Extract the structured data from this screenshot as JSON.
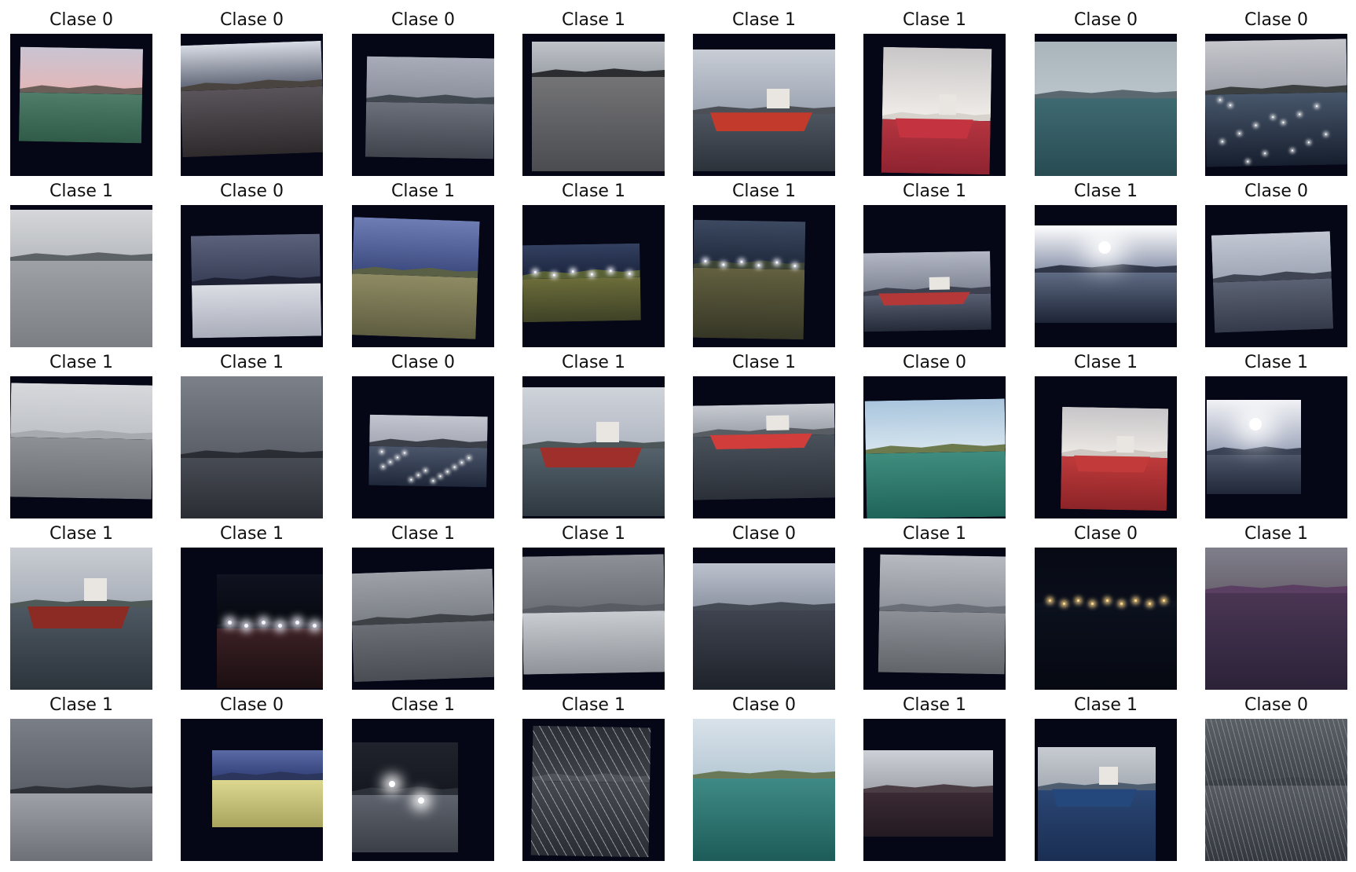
{
  "figure": {
    "cells": [
      {
        "label": "Clase 0",
        "scene": "harbor-dusk"
      },
      {
        "label": "Clase 0",
        "scene": "pier-cloudy"
      },
      {
        "label": "Clase 0",
        "scene": "harbor-gray"
      },
      {
        "label": "Clase 1",
        "scene": "coal-yard"
      },
      {
        "label": "Clase 1",
        "scene": "red-ship-crane"
      },
      {
        "label": "Clase 1",
        "scene": "red-ship-stern"
      },
      {
        "label": "Clase 0",
        "scene": "open-sea-overcast"
      },
      {
        "label": "Clase 0",
        "scene": "sea-glitter"
      },
      {
        "label": "Clase 1",
        "scene": "gray-port-ship"
      },
      {
        "label": "Clase 0",
        "scene": "night-pile"
      },
      {
        "label": "Clase 1",
        "scene": "crane-evening"
      },
      {
        "label": "Clase 1",
        "scene": "night-crane-lights"
      },
      {
        "label": "Clase 1",
        "scene": "night-dock"
      },
      {
        "label": "Clase 1",
        "scene": "tug-ship-dusk"
      },
      {
        "label": "Clase 1",
        "scene": "sun-glare"
      },
      {
        "label": "Clase 0",
        "scene": "harbor-gray-dark"
      },
      {
        "label": "Clase 1",
        "scene": "ship-ir-closeup"
      },
      {
        "label": "Clase 1",
        "scene": "cranes-night-gray"
      },
      {
        "label": "Clase 0",
        "scene": "small-sea-glitter"
      },
      {
        "label": "Clase 1",
        "scene": "port-small-ship"
      },
      {
        "label": "Clase 1",
        "scene": "red-ship-side"
      },
      {
        "label": "Clase 0",
        "scene": "green-sea-hill"
      },
      {
        "label": "Clase 1",
        "scene": "red-ship-stern-small"
      },
      {
        "label": "Clase 1",
        "scene": "bright-glare-small"
      },
      {
        "label": "Clase 1",
        "scene": "harbor-ship-quay"
      },
      {
        "label": "Clase 1",
        "scene": "night-ship-lights"
      },
      {
        "label": "Clase 1",
        "scene": "cranes-ir"
      },
      {
        "label": "Clase 1",
        "scene": "blurred-white"
      },
      {
        "label": "Clase 0",
        "scene": "quay-dusk"
      },
      {
        "label": "Clase 1",
        "scene": "blurred-ship"
      },
      {
        "label": "Clase 0",
        "scene": "night-water-lights"
      },
      {
        "label": "Clase 1",
        "scene": "blurred-purple"
      },
      {
        "label": "Clase 1",
        "scene": "cranes-ir-wide"
      },
      {
        "label": "Clase 0",
        "scene": "pile-yellow"
      },
      {
        "label": "Clase 1",
        "scene": "night-spotlights"
      },
      {
        "label": "Clase 1",
        "scene": "scratched-ir"
      },
      {
        "label": "Clase 0",
        "scene": "green-sea-coast"
      },
      {
        "label": "Clase 1",
        "scene": "blurred-ship-dark"
      },
      {
        "label": "Clase 1",
        "scene": "blue-ship"
      },
      {
        "label": "Clase 0",
        "scene": "rain-noise"
      }
    ]
  }
}
